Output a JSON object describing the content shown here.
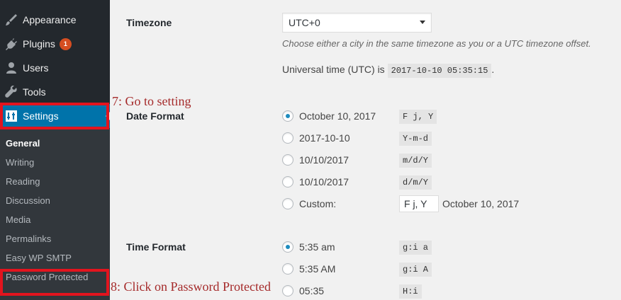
{
  "sidebar": {
    "items": [
      {
        "label": "Appearance",
        "icon": "paintbrush-icon"
      },
      {
        "label": "Plugins",
        "icon": "plugin-icon",
        "badge": "1"
      },
      {
        "label": "Users",
        "icon": "users-icon"
      },
      {
        "label": "Tools",
        "icon": "wrench-icon"
      },
      {
        "label": "Settings",
        "icon": "settings-icon"
      }
    ],
    "submenu": [
      "General",
      "Writing",
      "Reading",
      "Discussion",
      "Media",
      "Permalinks",
      "Easy WP SMTP",
      "Password Protected"
    ]
  },
  "annotations": {
    "step7": "7: Go to setting",
    "step8": "8: Click on Password Protected"
  },
  "timezone": {
    "label": "Timezone",
    "selected": "UTC+0",
    "description": "Choose either a city in the same timezone as you or a UTC timezone offset.",
    "universal_label": "Universal time (UTC) is",
    "universal_value": "2017-10-10 05:35:15",
    "universal_suffix": "."
  },
  "date_format": {
    "label": "Date Format",
    "options": [
      {
        "label": "October 10, 2017",
        "code": "F j, Y",
        "checked": true
      },
      {
        "label": "2017-10-10",
        "code": "Y-m-d",
        "checked": false
      },
      {
        "label": "10/10/2017",
        "code": "m/d/Y",
        "checked": false
      },
      {
        "label": "10/10/2017",
        "code": "d/m/Y",
        "checked": false
      }
    ],
    "custom_label": "Custom:",
    "custom_value": "F j, Y",
    "custom_preview": "October 10, 2017"
  },
  "time_format": {
    "label": "Time Format",
    "options": [
      {
        "label": "5:35 am",
        "code": "g:i a",
        "checked": true
      },
      {
        "label": "5:35 AM",
        "code": "g:i A",
        "checked": false
      },
      {
        "label": "05:35",
        "code": "H:i",
        "checked": false
      }
    ]
  },
  "colors": {
    "sidebar_bg": "#23282d",
    "submenu_bg": "#32373c",
    "accent": "#0073aa",
    "highlight": "#e3141e",
    "badge": "#d54e21",
    "annotation_text": "#a52a2a"
  }
}
